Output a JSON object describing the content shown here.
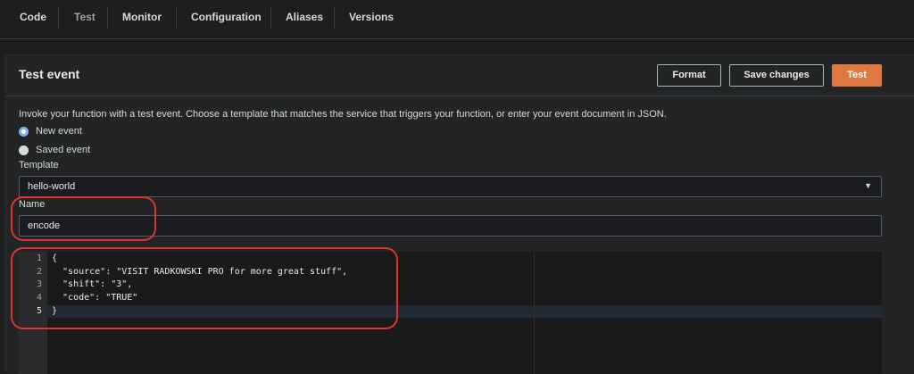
{
  "tabs": [
    {
      "label": "Code"
    },
    {
      "label": "Test"
    },
    {
      "label": "Monitor"
    },
    {
      "label": "Configuration"
    },
    {
      "label": "Aliases"
    },
    {
      "label": "Versions"
    }
  ],
  "panel": {
    "title": "Test event",
    "buttons": {
      "format": "Format",
      "save": "Save changes",
      "test": "Test"
    },
    "description": "Invoke your function with a test event. Choose a template that matches the service that triggers your function, or enter your event document in JSON.",
    "radio_options": [
      {
        "label": "New event",
        "checked": true
      },
      {
        "label": "Saved event",
        "checked": false
      }
    ],
    "template": {
      "label": "Template",
      "value": "hello-world"
    },
    "name": {
      "label": "Name",
      "value": "encode"
    }
  },
  "editor": {
    "lines": [
      {
        "num": "1",
        "code": "{"
      },
      {
        "num": "2",
        "code": "  \"source\": \"VISIT RADKOWSKI PRO for more great stuff\","
      },
      {
        "num": "3",
        "code": "  \"shift\": \"3\","
      },
      {
        "num": "4",
        "code": "  \"code\": \"TRUE\""
      },
      {
        "num": "5",
        "code": "}"
      }
    ],
    "active_line": "5"
  },
  "colors": {
    "primary_button": "#e07941",
    "annotation": "#e0332e",
    "radio_selected": "#7fb3e6"
  }
}
